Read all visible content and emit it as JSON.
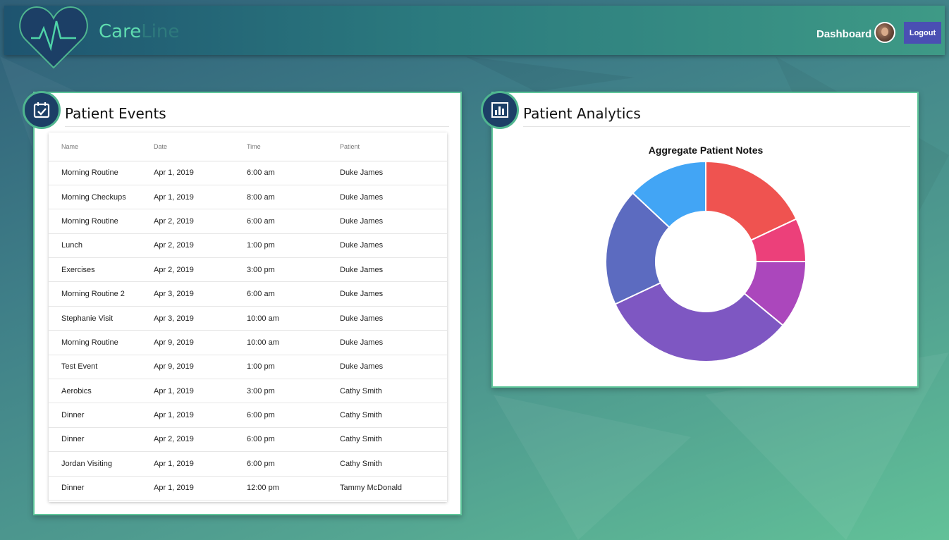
{
  "app": {
    "brand_part1": "Care",
    "brand_part2": "Line",
    "nav_dashboard": "Dashboard",
    "logout_label": "Logout"
  },
  "events_panel": {
    "title": "Patient Events",
    "columns": [
      "Name",
      "Date",
      "Time",
      "Patient"
    ],
    "rows": [
      [
        "Morning Routine",
        "Apr 1, 2019",
        "6:00 am",
        "Duke James"
      ],
      [
        "Morning Checkups",
        "Apr 1, 2019",
        "8:00 am",
        "Duke James"
      ],
      [
        "Morning Routine",
        "Apr 2, 2019",
        "6:00 am",
        "Duke James"
      ],
      [
        "Lunch",
        "Apr 2, 2019",
        "1:00 pm",
        "Duke James"
      ],
      [
        "Exercises",
        "Apr 2, 2019",
        "3:00 pm",
        "Duke James"
      ],
      [
        "Morning Routine 2",
        "Apr 3, 2019",
        "6:00 am",
        "Duke James"
      ],
      [
        "Stephanie Visit",
        "Apr 3, 2019",
        "10:00 am",
        "Duke James"
      ],
      [
        "Morning Routine",
        "Apr 9, 2019",
        "10:00 am",
        "Duke James"
      ],
      [
        "Test Event",
        "Apr 9, 2019",
        "1:00 pm",
        "Duke James"
      ],
      [
        "Aerobics",
        "Apr 1, 2019",
        "3:00 pm",
        "Cathy Smith"
      ],
      [
        "Dinner",
        "Apr 1, 2019",
        "6:00 pm",
        "Cathy Smith"
      ],
      [
        "Dinner",
        "Apr 2, 2019",
        "6:00 pm",
        "Cathy Smith"
      ],
      [
        "Jordan Visiting",
        "Apr 1, 2019",
        "6:00 pm",
        "Cathy Smith"
      ],
      [
        "Dinner",
        "Apr 1, 2019",
        "12:00 pm",
        "Tammy McDonald"
      ]
    ]
  },
  "analytics_panel": {
    "title": "Patient Analytics"
  },
  "colors": {
    "accent_green": "#5fc69a",
    "navy": "#1c3f66",
    "logout_bg": "#4a4fb3"
  },
  "icons": [
    "heart-pulse-logo-icon",
    "calendar-check-icon",
    "bar-chart-icon"
  ],
  "chart_data": {
    "type": "pie",
    "title": "Aggregate Patient Notes",
    "donut": true,
    "values": [
      18,
      7,
      11,
      32,
      19,
      13
    ],
    "colors": [
      "#ef5350",
      "#ec407a",
      "#ab47bc",
      "#7e57c2",
      "#5c6bc0",
      "#42a5f5"
    ]
  }
}
